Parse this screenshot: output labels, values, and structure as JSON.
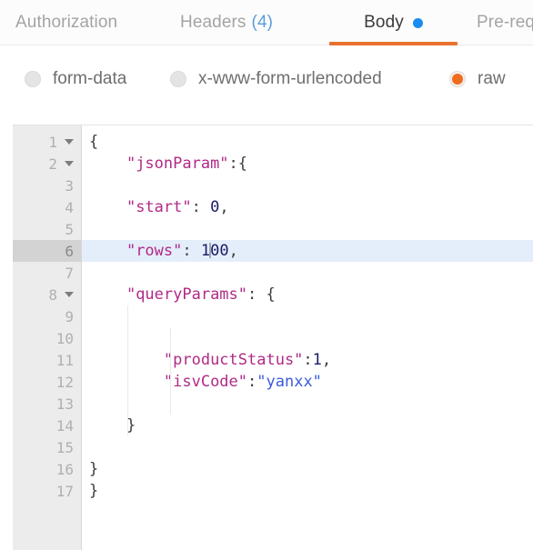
{
  "theme": {
    "accent_orange": "#e8712e",
    "accent_blue": "#1a8cf0",
    "count_blue": "#5c9ddb",
    "active_line_bg": "#e4eefb",
    "gutter_bg": "#ececec",
    "key_color": "#b02a87",
    "string_color": "#3b5bdb",
    "number_color": "#1a1a66"
  },
  "tabs": [
    {
      "label": "Authorization",
      "active": false,
      "count": "",
      "dot": false
    },
    {
      "label": "Headers",
      "active": false,
      "count": "(4)",
      "dot": false
    },
    {
      "label": "Body",
      "active": true,
      "count": "",
      "dot": true
    },
    {
      "label": "Pre-requ",
      "active": false,
      "count": "",
      "dot": false
    }
  ],
  "body_type_options": [
    {
      "label": "form-data",
      "selected": false
    },
    {
      "label": "x-www-form-urlencoded",
      "selected": false
    },
    {
      "label": "raw",
      "selected": true
    }
  ],
  "editor": {
    "active_line": 6,
    "total_lines": 17,
    "line_numbers": [
      "1",
      "2",
      "3",
      "4",
      "5",
      "6",
      "7",
      "8",
      "9",
      "10",
      "11",
      "12",
      "13",
      "14",
      "15",
      "16",
      "17"
    ],
    "fold_lines": [
      1,
      2,
      8
    ],
    "raw_text": "{\n    \"jsonParam\":{\n\n    \"start\": 0,\n\n    \"rows\": 100,\n\n    \"queryParams\": {\n\n\n        \"productStatus\":1,\n        \"isvCode\":\"yanxx\"\n\n    }\n\n}\n}",
    "lines": [
      {
        "n": 1,
        "tokens": [
          {
            "t": "brace",
            "v": "{"
          }
        ]
      },
      {
        "n": 2,
        "tokens": [
          {
            "t": "plain",
            "v": "    "
          },
          {
            "t": "key",
            "v": "\"jsonParam\""
          },
          {
            "t": "punct",
            "v": ":"
          },
          {
            "t": "brace",
            "v": "{"
          }
        ]
      },
      {
        "n": 3,
        "tokens": []
      },
      {
        "n": 4,
        "tokens": [
          {
            "t": "plain",
            "v": "    "
          },
          {
            "t": "key",
            "v": "\"start\""
          },
          {
            "t": "punct",
            "v": ": "
          },
          {
            "t": "num",
            "v": "0"
          },
          {
            "t": "punct",
            "v": ","
          }
        ]
      },
      {
        "n": 5,
        "tokens": []
      },
      {
        "n": 6,
        "tokens": [
          {
            "t": "plain",
            "v": "    "
          },
          {
            "t": "key",
            "v": "\"rows\""
          },
          {
            "t": "punct",
            "v": ": "
          },
          {
            "t": "num",
            "v": "1"
          },
          {
            "t": "caret",
            "v": ""
          },
          {
            "t": "num",
            "v": "00"
          },
          {
            "t": "punct",
            "v": ","
          }
        ]
      },
      {
        "n": 7,
        "tokens": []
      },
      {
        "n": 8,
        "tokens": [
          {
            "t": "plain",
            "v": "    "
          },
          {
            "t": "key",
            "v": "\"queryParams\""
          },
          {
            "t": "punct",
            "v": ": "
          },
          {
            "t": "brace",
            "v": "{"
          }
        ]
      },
      {
        "n": 9,
        "tokens": []
      },
      {
        "n": 10,
        "tokens": []
      },
      {
        "n": 11,
        "tokens": [
          {
            "t": "plain",
            "v": "        "
          },
          {
            "t": "key",
            "v": "\"productStatus\""
          },
          {
            "t": "punct",
            "v": ":"
          },
          {
            "t": "num",
            "v": "1"
          },
          {
            "t": "punct",
            "v": ","
          }
        ]
      },
      {
        "n": 12,
        "tokens": [
          {
            "t": "plain",
            "v": "        "
          },
          {
            "t": "key",
            "v": "\"isvCode\""
          },
          {
            "t": "punct",
            "v": ":"
          },
          {
            "t": "str",
            "v": "\"yanxx\""
          }
        ]
      },
      {
        "n": 13,
        "tokens": []
      },
      {
        "n": 14,
        "tokens": [
          {
            "t": "plain",
            "v": "    "
          },
          {
            "t": "brace",
            "v": "}"
          }
        ]
      },
      {
        "n": 15,
        "tokens": []
      },
      {
        "n": 16,
        "tokens": [
          {
            "t": "brace",
            "v": "}"
          }
        ]
      },
      {
        "n": 17,
        "tokens": [
          {
            "t": "brace",
            "v": "}"
          }
        ]
      }
    ]
  }
}
